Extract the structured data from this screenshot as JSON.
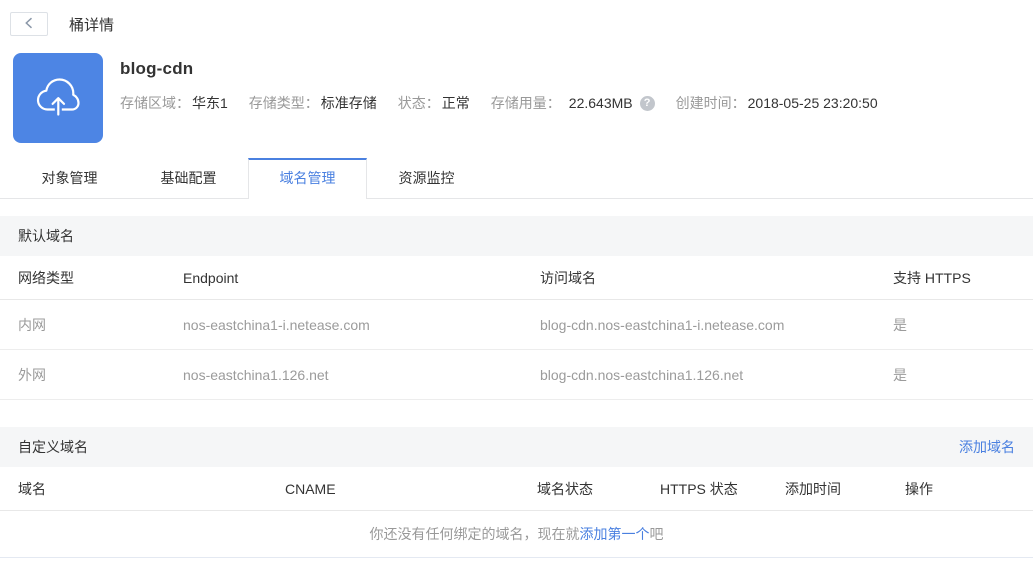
{
  "topbar": {
    "title": "桶详情"
  },
  "header": {
    "bucket_name": "blog-cdn",
    "fields": [
      {
        "label": "存储区域：",
        "value": "华东1"
      },
      {
        "label": "存储类型：",
        "value": "标准存储"
      },
      {
        "label": "状态：",
        "value": "正常"
      },
      {
        "label": "存储用量：",
        "value": "22.643MB"
      },
      {
        "label": "创建时间：",
        "value": "2018-05-25 23:20:50"
      }
    ],
    "usage_help_glyph": "?"
  },
  "tabs": [
    {
      "label": "对象管理",
      "active": false
    },
    {
      "label": "基础配置",
      "active": false
    },
    {
      "label": "域名管理",
      "active": true
    },
    {
      "label": "资源监控",
      "active": false
    }
  ],
  "default_domain": {
    "section_title": "默认域名",
    "columns": [
      "网络类型",
      "Endpoint",
      "访问域名",
      "支持 HTTPS"
    ],
    "rows": [
      [
        "内网",
        "nos-eastchina1-i.netease.com",
        "blog-cdn.nos-eastchina1-i.netease.com",
        "是"
      ],
      [
        "外网",
        "nos-eastchina1.126.net",
        "blog-cdn.nos-eastchina1.126.net",
        "是"
      ]
    ]
  },
  "custom_domain": {
    "section_title": "自定义域名",
    "add_link_label": "添加域名",
    "columns": [
      "域名",
      "CNAME",
      "域名状态",
      "HTTPS 状态",
      "添加时间",
      "操作"
    ],
    "empty_state": {
      "prefix": "你还没有任何绑定的域名，现在就",
      "link": "添加第一个",
      "suffix": "吧"
    }
  },
  "icons": {
    "back": "chevron-left",
    "bucket": "cloud-upload",
    "usage_help": "question-mark-circle"
  },
  "colors": {
    "accent_blue": "#4a80e0",
    "bucket_icon_blue": "#4d85e4",
    "section_bar_bg": "#f5f6f7",
    "label_gray": "#999999",
    "text_dark": "#333333",
    "table_border": "#e8e8e8"
  }
}
